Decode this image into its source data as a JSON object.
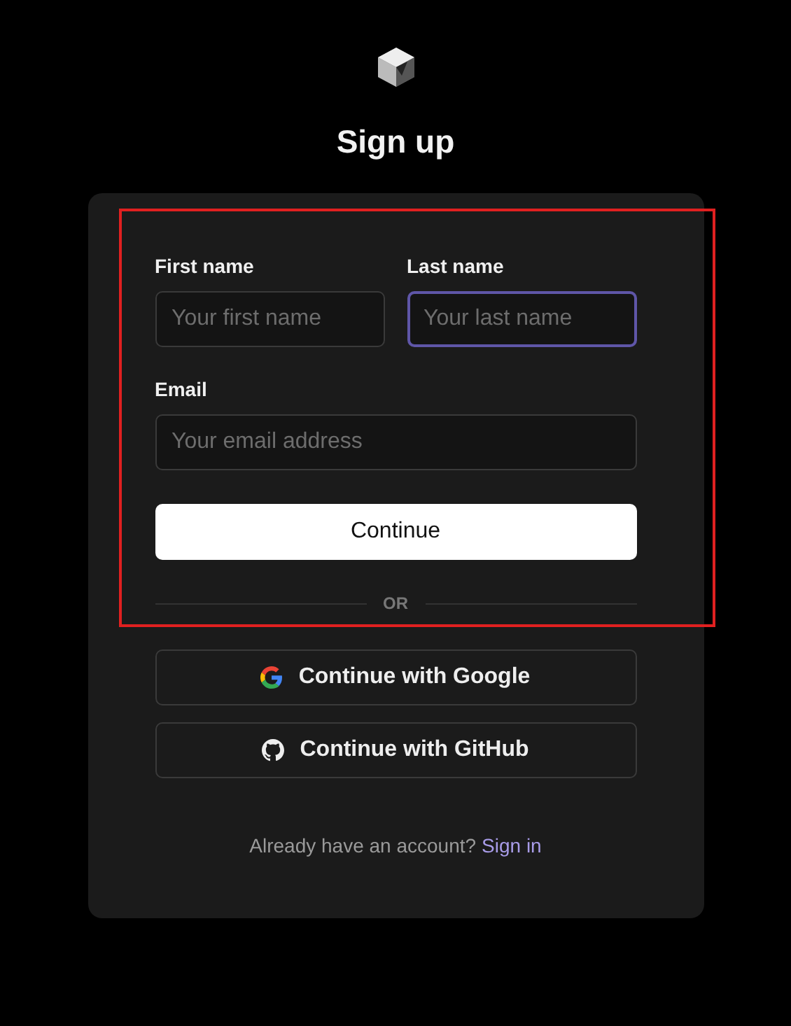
{
  "title": "Sign up",
  "name_fields": [
    {
      "label": "First name",
      "placeholder": "Your first name",
      "focused": false
    },
    {
      "label": "Last name",
      "placeholder": "Your last name",
      "focused": true
    }
  ],
  "email_field": {
    "label": "Email",
    "placeholder": "Your email address",
    "focused": false
  },
  "continue_button": "Continue",
  "divider": "OR",
  "providers": [
    {
      "kind": "google",
      "label": "Continue with Google"
    },
    {
      "kind": "github",
      "label": "Continue with GitHub"
    }
  ],
  "footer": {
    "text": "Already have an account?",
    "link": "Sign in"
  }
}
